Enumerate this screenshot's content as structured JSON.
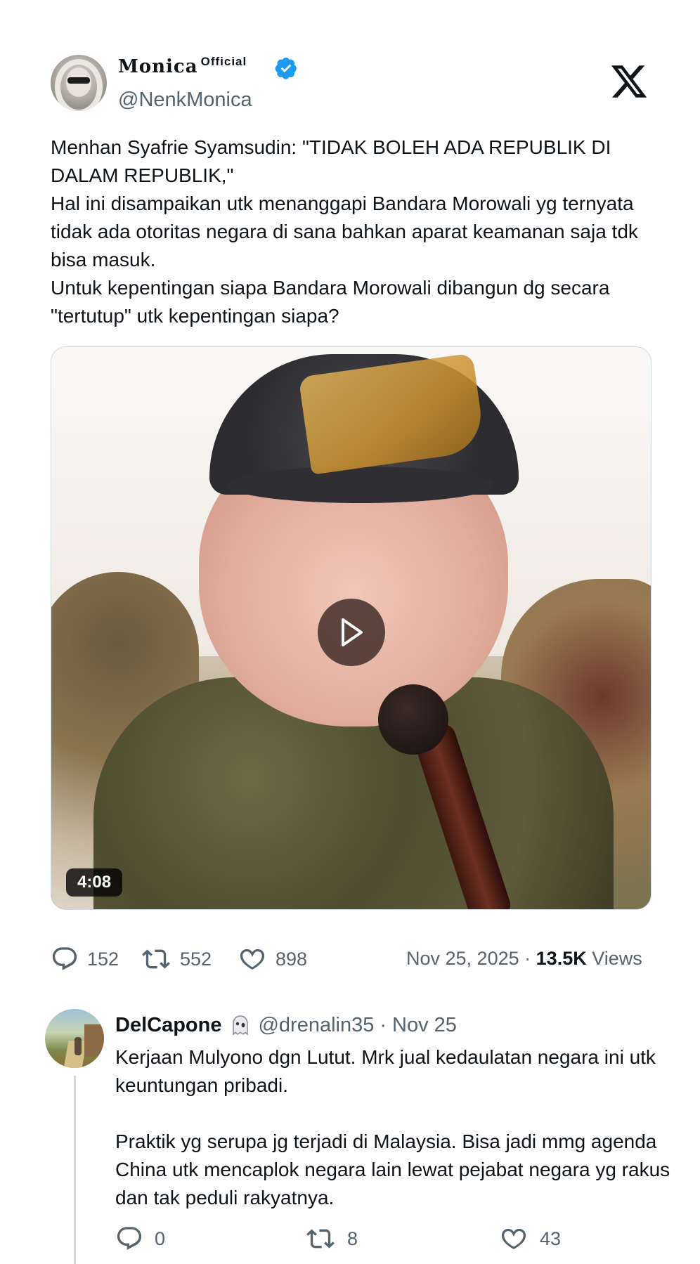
{
  "tweet": {
    "author": {
      "display_name": "Monica",
      "display_name_suffix": "Official",
      "handle": "@NenkMonica",
      "verified": true
    },
    "text_lines": [
      "Menhan Syafrie Syamsudin: \"TIDAK BOLEH ADA REPUBLIK DI DALAM REPUBLIK,\"",
      "Hal ini disampaikan utk menanggapi Bandara Morowali yg ternyata tidak ada otoritas negara di sana bahkan aparat keamanan saja tdk bisa masuk.",
      "Untuk kepentingan siapa Bandara Morowali dibangun dg secara \"tertutup\" utk kepentingan siapa?"
    ],
    "media": {
      "duration": "4:08",
      "icon": "play-icon"
    },
    "stats": {
      "replies": "152",
      "retweets": "552",
      "likes": "898",
      "date": "Nov 25, 2025",
      "separator": "·",
      "views_count": "13.5K",
      "views_label": "Views"
    }
  },
  "reply": {
    "author": {
      "display_name": "DelCapone",
      "emoji": "ghost-icon",
      "handle": "@drenalin35",
      "separator": "·",
      "date": "Nov 25"
    },
    "paragraph_1": "Kerjaan Mulyono dgn Lutut. Mrk jual kedaulatan negara ini utk keuntungan pribadi.",
    "paragraph_2": "Praktik yg serupa jg terjadi di Malaysia. Bisa jadi mmg agenda China utk mencaplok negara lain lewat pejabat negara yg rakus dan tak peduli rakyatnya.",
    "stats": {
      "replies": "0",
      "retweets": "8",
      "likes": "43"
    }
  },
  "brand": {
    "logo": "x-logo-icon"
  },
  "colors": {
    "text_primary": "#0f1419",
    "text_secondary": "#536471",
    "verified_blue": "#1d9bf0",
    "border": "#cfd9de"
  }
}
